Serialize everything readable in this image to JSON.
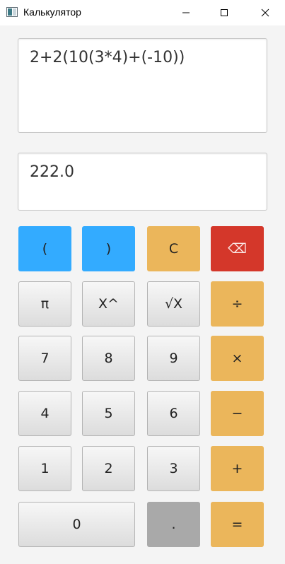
{
  "window": {
    "title": "Калькулятор"
  },
  "display": {
    "expression": "2+2(10(3*4)+(-10))",
    "result": "222.0"
  },
  "keypad": {
    "open_paren": "(",
    "close_paren": ")",
    "clear": "C",
    "backspace": "⌫",
    "pi": "π",
    "power": "X^",
    "sqrt": "√X",
    "divide": "÷",
    "seven": "7",
    "eight": "8",
    "nine": "9",
    "multiply": "×",
    "four": "4",
    "five": "5",
    "six": "6",
    "minus": "−",
    "one": "1",
    "two": "2",
    "three": "3",
    "plus": "+",
    "zero": "0",
    "dot": ".",
    "equals": "="
  },
  "colors": {
    "paren_button": "#33abff",
    "operator_button": "#ebb65b",
    "backspace_button": "#d4372a",
    "dot_button": "#a9a9a9"
  }
}
